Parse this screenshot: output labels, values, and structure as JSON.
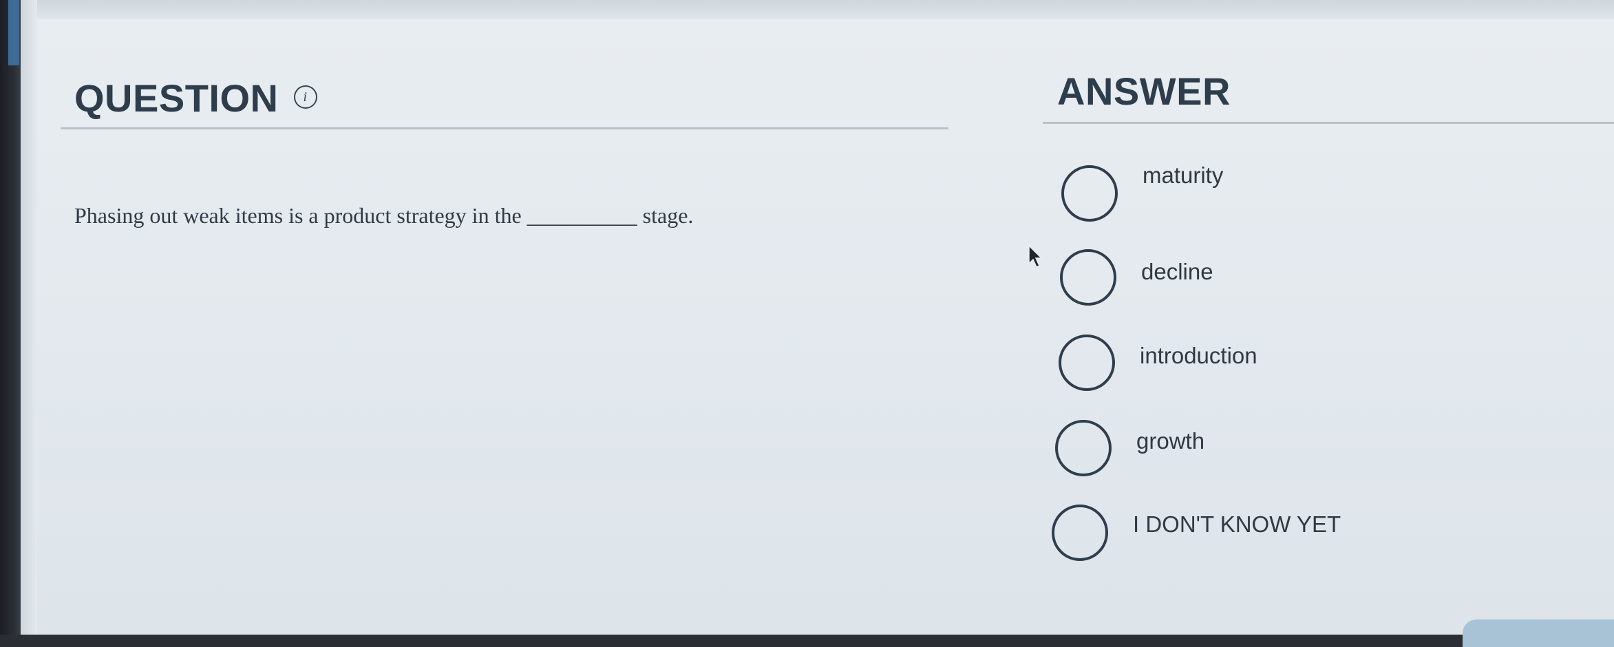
{
  "question": {
    "heading": "QUESTION",
    "info_symbol": "i",
    "text_before": "Phasing out weak items is a product strategy in the ",
    "blank": "__________",
    "text_after": " stage."
  },
  "answer": {
    "heading": "ANSWER",
    "options": [
      {
        "label": "maturity"
      },
      {
        "label": "decline"
      },
      {
        "label": "introduction"
      },
      {
        "label": "growth"
      },
      {
        "label": "I DON'T KNOW YET"
      }
    ]
  },
  "colors": {
    "heading": "#2e3d4c",
    "body_text": "#2f3a45",
    "radio_border": "#2f3e4d",
    "panel_bg": "#e5eaef",
    "accent": "#3f6b95"
  },
  "icons": [
    "info-icon",
    "mouse-cursor-icon"
  ]
}
